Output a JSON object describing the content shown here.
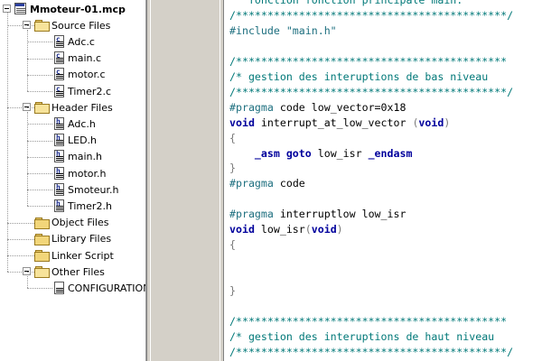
{
  "project": {
    "title": "Mmoteur-01.mcp",
    "folders": [
      {
        "label": "Source Files",
        "files": [
          {
            "name": "Adc.c",
            "type": "c"
          },
          {
            "name": "main.c",
            "type": "c"
          },
          {
            "name": "motor.c",
            "type": "c"
          },
          {
            "name": "Timer2.c",
            "type": "c"
          }
        ]
      },
      {
        "label": "Header Files",
        "files": [
          {
            "name": "Adc.h",
            "type": "h"
          },
          {
            "name": "LED.h",
            "type": "h"
          },
          {
            "name": "main.h",
            "type": "h"
          },
          {
            "name": "motor.h",
            "type": "h"
          },
          {
            "name": "Smoteur.h",
            "type": "h"
          },
          {
            "name": "Timer2.h",
            "type": "h"
          }
        ]
      },
      {
        "label": "Object Files",
        "files": []
      },
      {
        "label": "Library Files",
        "files": []
      },
      {
        "label": "Linker Script",
        "files": []
      },
      {
        "label": "Other Files",
        "files": [
          {
            "name": "CONFIGURATION",
            "type": "txt"
          }
        ]
      }
    ]
  },
  "editor": {
    "lines": [
      [
        {
          "t": "   fonction fonction principale main.",
          "c": "com"
        }
      ],
      [
        {
          "t": "/*******************************************/",
          "c": "com"
        }
      ],
      [
        {
          "t": "#include \"main.h\"",
          "c": "pp"
        }
      ],
      [],
      [
        {
          "t": "/*******************************************",
          "c": "com"
        }
      ],
      [
        {
          "t": "/* gestion des interuptions de bas niveau",
          "c": "com"
        }
      ],
      [
        {
          "t": "/*******************************************/",
          "c": "com"
        }
      ],
      [
        {
          "t": "#pragma",
          "c": "pp"
        },
        {
          "t": " code low_vector=0x18",
          "c": "txt"
        }
      ],
      [
        {
          "t": "void",
          "c": "kw"
        },
        {
          "t": " interrupt_at_low_vector ",
          "c": "txt"
        },
        {
          "t": "(",
          "c": "br"
        },
        {
          "t": "void",
          "c": "kw"
        },
        {
          "t": ")",
          "c": "br"
        }
      ],
      [
        {
          "t": "{",
          "c": "br"
        }
      ],
      [
        {
          "t": "    ",
          "c": "txt"
        },
        {
          "t": "_asm goto",
          "c": "kw"
        },
        {
          "t": " low_isr ",
          "c": "txt"
        },
        {
          "t": "_endasm",
          "c": "kw"
        }
      ],
      [
        {
          "t": "}",
          "c": "br"
        }
      ],
      [
        {
          "t": "#pragma",
          "c": "pp"
        },
        {
          "t": " code",
          "c": "txt"
        }
      ],
      [],
      [
        {
          "t": "#pragma",
          "c": "pp"
        },
        {
          "t": " interruptlow low_isr",
          "c": "txt"
        }
      ],
      [
        {
          "t": "void",
          "c": "kw"
        },
        {
          "t": " low_isr",
          "c": "txt"
        },
        {
          "t": "(",
          "c": "br"
        },
        {
          "t": "void",
          "c": "kw"
        },
        {
          "t": ")",
          "c": "br"
        }
      ],
      [
        {
          "t": "{",
          "c": "br"
        }
      ],
      [],
      [],
      [
        {
          "t": "}",
          "c": "br"
        }
      ],
      [],
      [
        {
          "t": "/*******************************************",
          "c": "com"
        }
      ],
      [
        {
          "t": "/* gestion des interuptions de haut niveau",
          "c": "com"
        }
      ],
      [
        {
          "t": "/*******************************************/",
          "c": "com"
        }
      ]
    ]
  }
}
